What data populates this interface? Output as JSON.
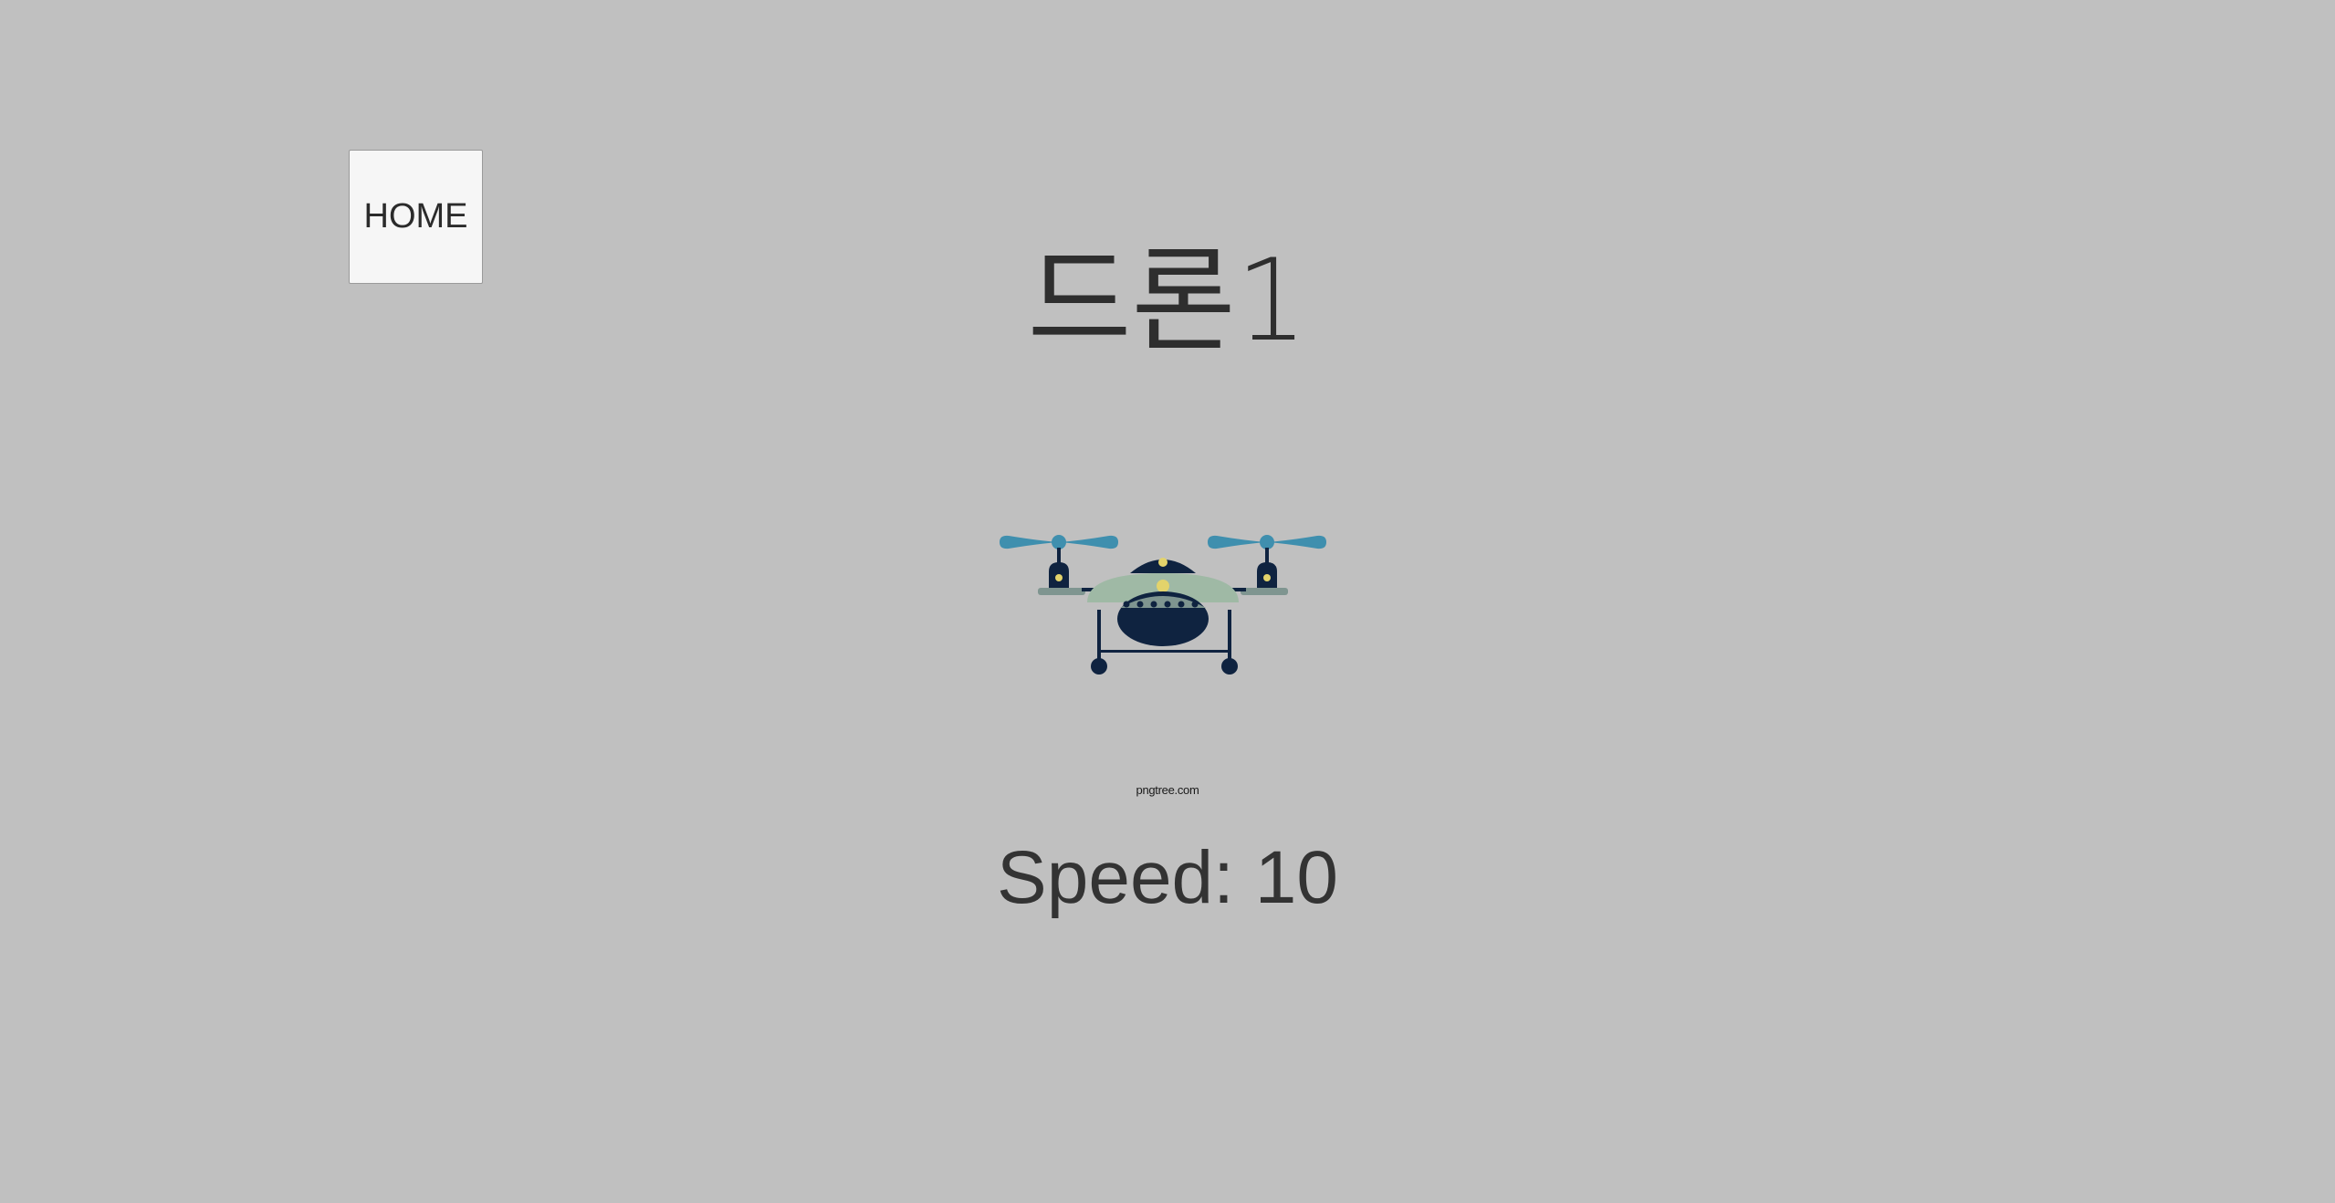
{
  "nav": {
    "home_label": "HOME"
  },
  "drone": {
    "title": "드론1",
    "image_icon": "drone-icon",
    "watermark": "pngtree.com",
    "speed_label": "Speed",
    "speed_value": 10,
    "speed_text": "Speed: 10"
  },
  "colors": {
    "background": "#c0c0c0",
    "button_bg": "#f6f6f6",
    "text": "#333333",
    "propeller": "#3f8fae",
    "drone_navy": "#0f2340",
    "drone_sage": "#9fb9a5",
    "drone_accent": "#e3d36b"
  }
}
